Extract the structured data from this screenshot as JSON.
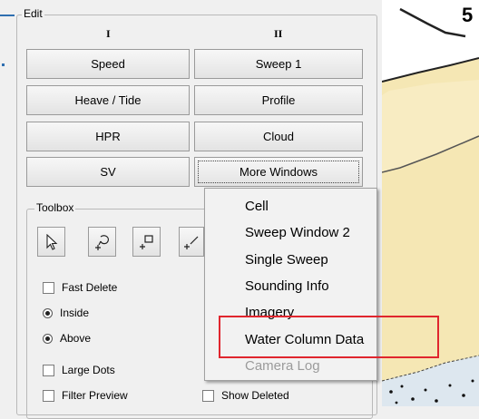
{
  "map": {
    "label": "5"
  },
  "edit": {
    "legend": "Edit",
    "col1": "I",
    "col2": "II",
    "buttons": {
      "speed": "Speed",
      "sweep1": "Sweep 1",
      "heave": "Heave / Tide",
      "profile": "Profile",
      "hpr": "HPR",
      "cloud": "Cloud",
      "sv": "SV",
      "more": "More Windows"
    }
  },
  "toolbox": {
    "legend": "Toolbox",
    "fast_delete": "Fast Delete",
    "inside": "Inside",
    "above": "Above",
    "large_dots": "Large Dots",
    "filter_preview": "Filter Preview",
    "show_deleted": "Show Deleted"
  },
  "menu": {
    "items": [
      {
        "label": "Cell",
        "enabled": true
      },
      {
        "label": "Sweep Window 2",
        "enabled": true
      },
      {
        "label": "Single Sweep",
        "enabled": true
      },
      {
        "label": "Sounding Info",
        "enabled": true
      },
      {
        "label": "Imagery",
        "enabled": true
      },
      {
        "label": "Water Column Data",
        "enabled": true,
        "highlighted": true
      },
      {
        "label": "Camera Log",
        "enabled": false
      }
    ]
  },
  "colors": {
    "highlight": "#e0262e",
    "accent": "#2f6fb0",
    "map_land": "#f5e7b4",
    "map_water": "#dde7ef"
  }
}
